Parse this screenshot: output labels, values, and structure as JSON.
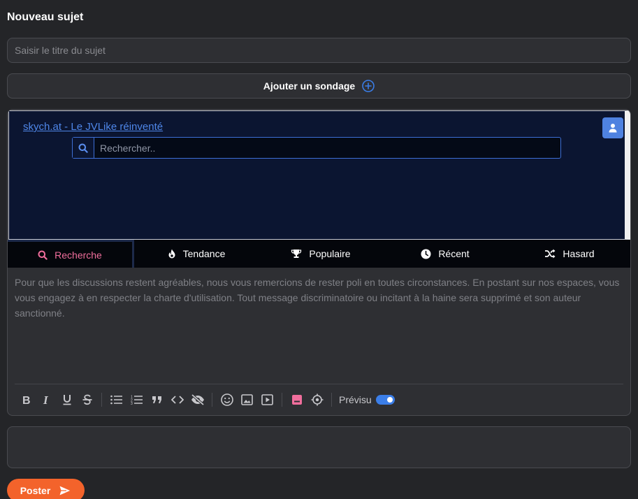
{
  "page": {
    "title": "Nouveau sujet"
  },
  "subject": {
    "title_placeholder": "Saisir le titre du sujet",
    "title_value": ""
  },
  "poll": {
    "button_label": "Ajouter un sondage"
  },
  "embed": {
    "link_text": "skych.at - Le JVLike réinventé",
    "search_placeholder": "Rechercher..",
    "tabs": [
      {
        "label": "Recherche",
        "icon": "search-icon",
        "active": true
      },
      {
        "label": "Tendance",
        "icon": "fire-icon",
        "active": false
      },
      {
        "label": "Populaire",
        "icon": "trophy-icon",
        "active": false
      },
      {
        "label": "Récent",
        "icon": "clock-icon",
        "active": false
      },
      {
        "label": "Hasard",
        "icon": "shuffle-icon",
        "active": false
      }
    ]
  },
  "message": {
    "placeholder": "Pour que les discussions restent agréables, nous vous remercions de rester poli en toutes circonstances. En postant sur nos espaces, vous vous engagez à en respecter la charte d'utilisation. Tout message discriminatoire ou incitant à la haine sera supprimé et son auteur sanctionné."
  },
  "toolbar": {
    "preview_label": "Prévisu",
    "preview_enabled": true
  },
  "actions": {
    "post_label": "Poster"
  },
  "colors": {
    "accent_orange": "#f3632b",
    "accent_blue": "#3b7ee8",
    "accent_pink": "#f06e9c",
    "background": "#242528"
  }
}
